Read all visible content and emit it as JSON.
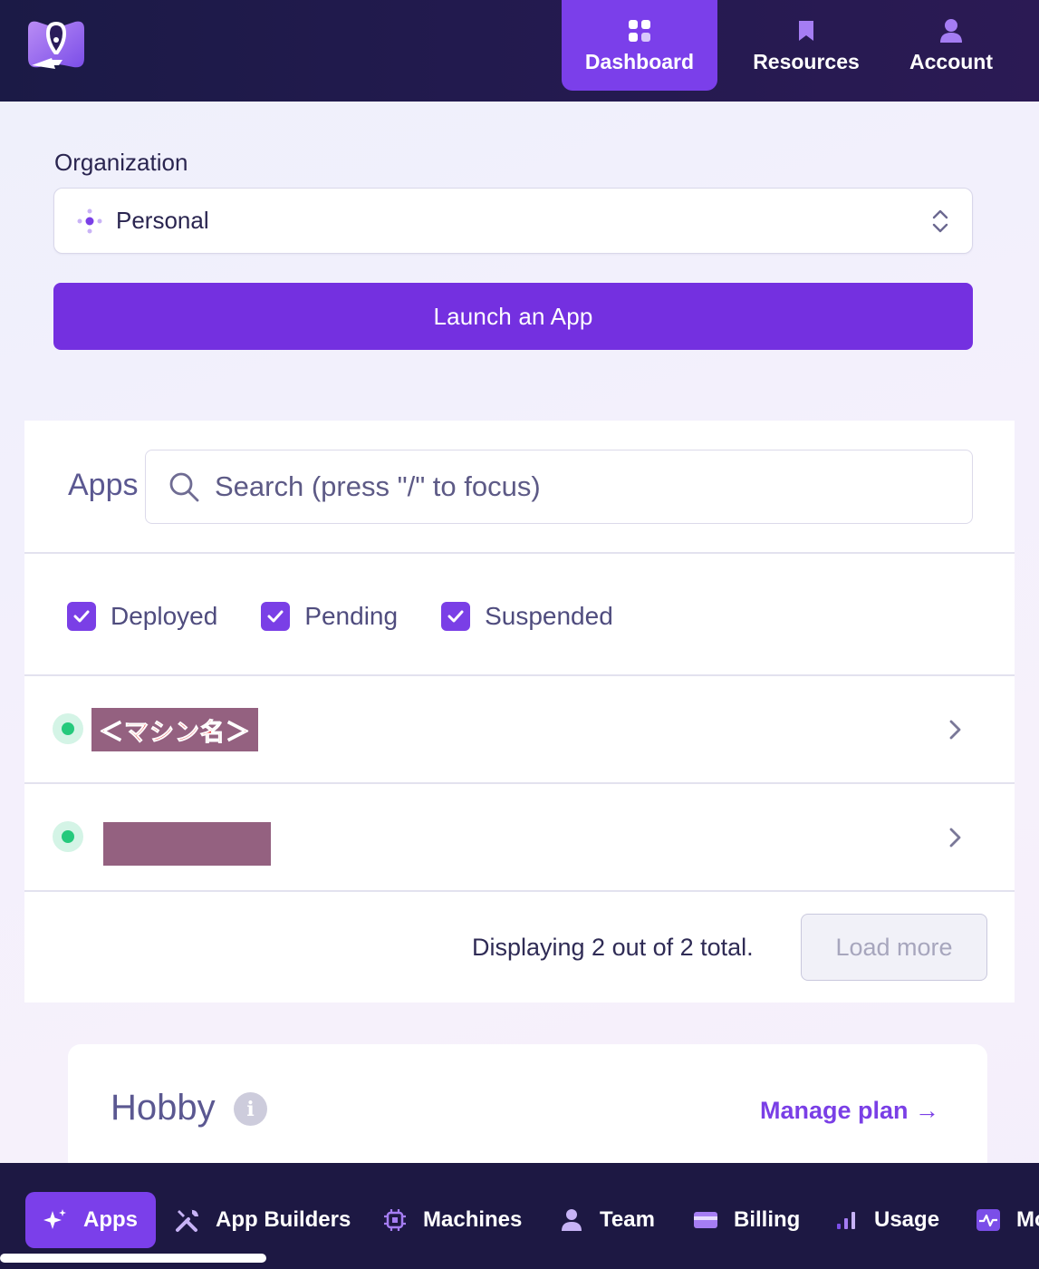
{
  "nav": {
    "items": [
      {
        "label": "Dashboard",
        "icon": "grid-icon",
        "active": true
      },
      {
        "label": "Resources",
        "icon": "bookmark-icon",
        "active": false
      },
      {
        "label": "Account",
        "icon": "user-icon",
        "active": false
      }
    ]
  },
  "organization": {
    "label": "Organization",
    "selected": "Personal"
  },
  "launch_button": "Launch an App",
  "apps": {
    "title": "Apps",
    "search_placeholder": "Search (press \"/\" to focus)",
    "filters": [
      {
        "label": "Deployed",
        "checked": true
      },
      {
        "label": "Pending",
        "checked": true
      },
      {
        "label": "Suspended",
        "checked": true
      }
    ],
    "rows": [
      {
        "name": "＜マシン名＞",
        "status": "deployed"
      },
      {
        "name": "",
        "status": "deployed"
      }
    ],
    "footer_text": "Displaying 2 out of 2 total.",
    "load_more": "Load more"
  },
  "plan": {
    "title": "Hobby",
    "manage_link": "Manage plan →"
  },
  "tabs": [
    {
      "label": "Apps",
      "icon": "sparkle-icon",
      "active": true
    },
    {
      "label": "App Builders",
      "icon": "tools-icon",
      "active": false
    },
    {
      "label": "Machines",
      "icon": "chip-icon",
      "active": false
    },
    {
      "label": "Team",
      "icon": "user-icon",
      "active": false
    },
    {
      "label": "Billing",
      "icon": "card-icon",
      "active": false
    },
    {
      "label": "Usage",
      "icon": "bar-chart-icon",
      "active": false
    },
    {
      "label": "Mo",
      "icon": "activity-icon",
      "active": false
    }
  ],
  "colors": {
    "accent": "#7b3fea",
    "nav_bg": "#1d1843",
    "status_ok": "#25c97c"
  }
}
